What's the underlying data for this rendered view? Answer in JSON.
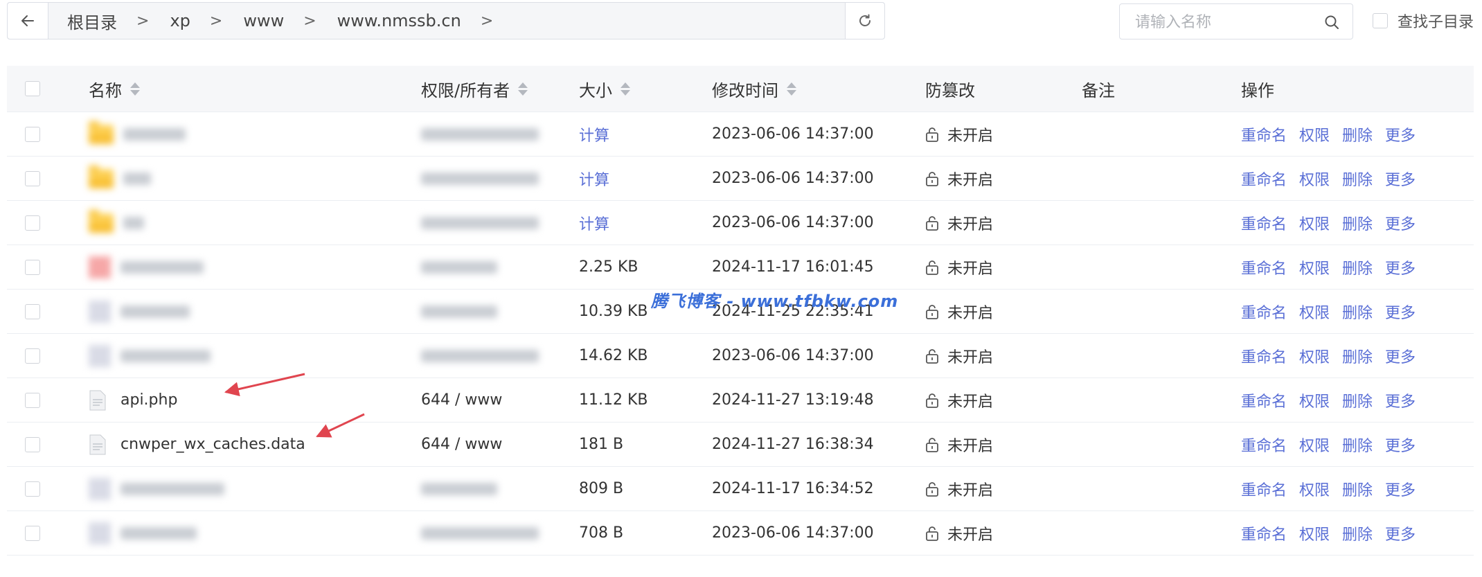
{
  "toolbar": {
    "breadcrumb": [
      "根目录",
      "xp",
      "www",
      "www.nmssb.cn"
    ],
    "separator": ">",
    "search_placeholder": "请输入名称",
    "subdir_label": "查找子目录"
  },
  "table": {
    "headers": {
      "name": "名称",
      "perm": "权限/所有者",
      "size": "大小",
      "mtime": "修改时间",
      "tamper": "防篡改",
      "note": "备注",
      "ops": "操作"
    },
    "ops": [
      "重命名",
      "权限",
      "删除",
      "更多"
    ],
    "rows": [
      {
        "kind": "folder",
        "name": "",
        "perm": "",
        "size": "计算",
        "mtime": "2023-06-06 14:37:00",
        "tamper": "未开启"
      },
      {
        "kind": "folder",
        "name": "",
        "perm": "",
        "size": "计算",
        "mtime": "2023-06-06 14:37:00",
        "tamper": "未开启"
      },
      {
        "kind": "folder",
        "name": "",
        "perm": "",
        "size": "计算",
        "mtime": "2023-06-06 14:37:00",
        "tamper": "未开启"
      },
      {
        "kind": "file",
        "name": "",
        "perm": "",
        "size": "2.25 KB",
        "mtime": "2024-11-17 16:01:45",
        "tamper": "未开启"
      },
      {
        "kind": "file",
        "name": "",
        "perm": "",
        "size": "10.39 KB",
        "mtime": "2024-11-25 22:35:41",
        "tamper": "未开启"
      },
      {
        "kind": "file",
        "name": "",
        "perm": "",
        "size": "14.62 KB",
        "mtime": "2023-06-06 14:37:00",
        "tamper": "未开启"
      },
      {
        "kind": "file",
        "name": "api.php",
        "perm": "644 / www",
        "size": "11.12 KB",
        "mtime": "2024-11-27 13:19:48",
        "tamper": "未开启"
      },
      {
        "kind": "file",
        "name": "cnwper_wx_caches.data",
        "perm": "644 / www",
        "size": "181 B",
        "mtime": "2024-11-27 16:38:34",
        "tamper": "未开启"
      },
      {
        "kind": "file",
        "name": "",
        "perm": "",
        "size": "809 B",
        "mtime": "2024-11-17 16:34:52",
        "tamper": "未开启"
      },
      {
        "kind": "file",
        "name": "",
        "perm": "",
        "size": "708 B",
        "mtime": "2023-06-06 14:37:00",
        "tamper": "未开启"
      }
    ]
  },
  "watermark": "腾飞博客 - www.tfbkw.com",
  "colors": {
    "link": "#5a6fd6",
    "arrow": "#e0454f",
    "watermark": "#3b6fd9"
  }
}
